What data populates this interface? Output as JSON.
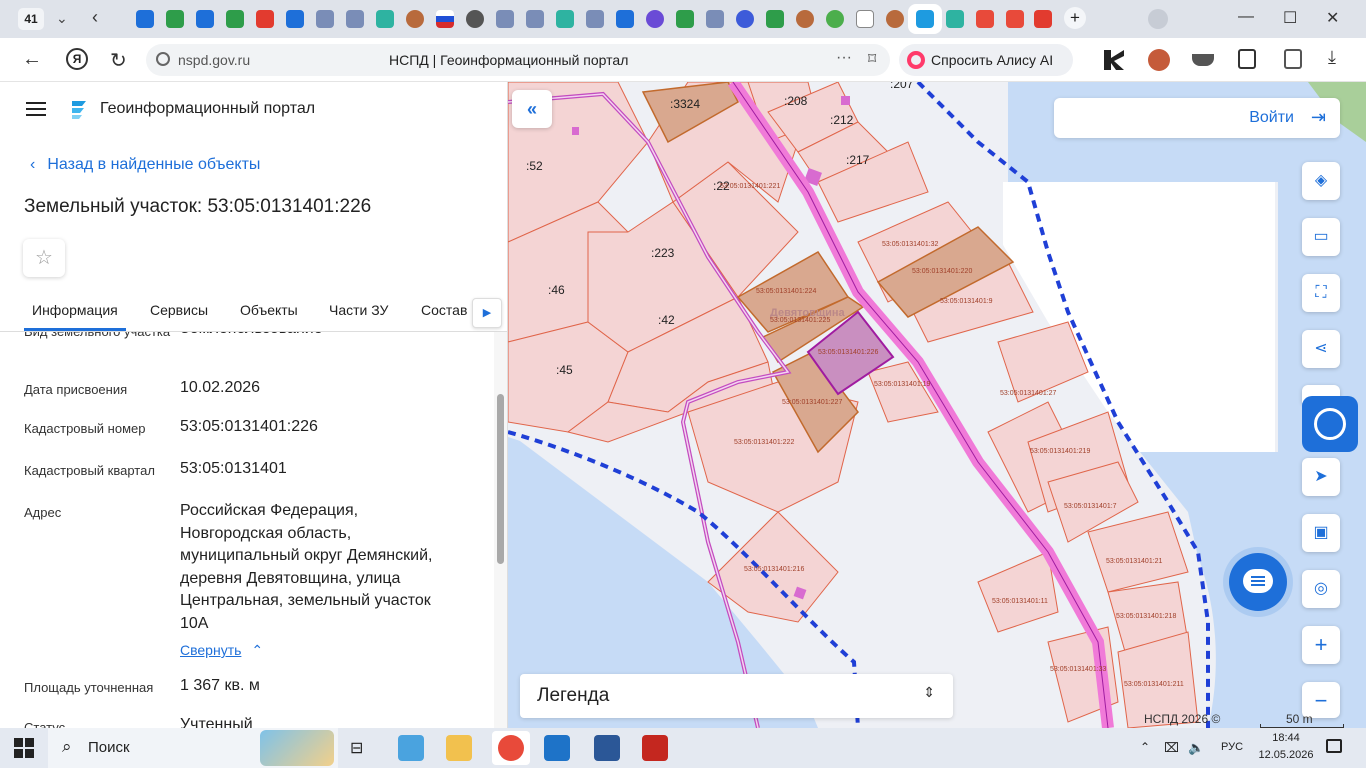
{
  "browser": {
    "tab_count": "41",
    "url": "nspd.gov.ru",
    "page_title": "НСПД | Геоинформационный портал",
    "alice_button": "Спросить Алису AI"
  },
  "app": {
    "title": "Геоинформационный портал",
    "back_link": "Назад в найденные объекты",
    "object_title": "Земельный участок: 53:05:0131401:226",
    "tabs": [
      "Информация",
      "Сервисы",
      "Объекты",
      "Части ЗУ",
      "Состав"
    ],
    "properties": [
      {
        "label": "Вид земельного участка",
        "value": "Землепользование"
      },
      {
        "label": "Дата присвоения",
        "value": "10.02.2026"
      },
      {
        "label": "Кадастровый номер",
        "value": "53:05:0131401:226"
      },
      {
        "label": "Кадастровый квартал",
        "value": "53:05:0131401"
      },
      {
        "label": "Адрес",
        "value": "Российская Федерация, Новгородская область, муниципальный округ Демянский, деревня Девятовщина, улица Центральная, земельный участок 10А"
      },
      {
        "label": "Площадь уточненная",
        "value": "1 367 кв. м"
      },
      {
        "label": "Статус",
        "value": "Учтенный"
      }
    ],
    "address_lines": [
      "Российская Федерация,",
      "Новгородская область,",
      "муниципальный округ Демянский,",
      "деревня Девятовщина, улица",
      "Центральная, земельный участок",
      "10А"
    ],
    "collapse_link": "Свернуть"
  },
  "map": {
    "login_button": "Войти",
    "legend": "Легенда",
    "copyright": "НСПД 2026 ©",
    "scale": "50 m",
    "village_label": "Девятовщина",
    "labels": [
      ":3324",
      ":208",
      ":212",
      ":217",
      ":207",
      ":52",
      ":22",
      "53:05:0131401:221",
      ":223",
      ":46",
      ":42",
      ":45",
      "53:05:0131401:224",
      "53:05:0131401:225",
      "53:05:0131401:226",
      "53:05:0131401:227",
      "53:05:0131401:222",
      "53:05:0131401:216",
      "53:05:0131401:32",
      "53:05:0131401:220",
      "53:05:0131401:9",
      "53:05:0131401:19",
      "53:05:0131401:27",
      "53:05:0131401:219",
      "53:05:0131401:7",
      "53:05:0131401:21",
      "53:05:0131401:11",
      "53:05:0131401:218",
      "53:05:0131401:33",
      "53:05:0131401:211"
    ],
    "colors": {
      "parcel_fill": "#f4d4d4",
      "parcel_stroke": "#e0654a",
      "selected": "#a01ca0",
      "road": "#f07ad8",
      "water": "#c6dbf6",
      "boundary": "#1f3fd6"
    }
  },
  "taskbar": {
    "search": "Поиск",
    "lang": "РУС",
    "time": "18:44",
    "date": "12.05.2026"
  }
}
